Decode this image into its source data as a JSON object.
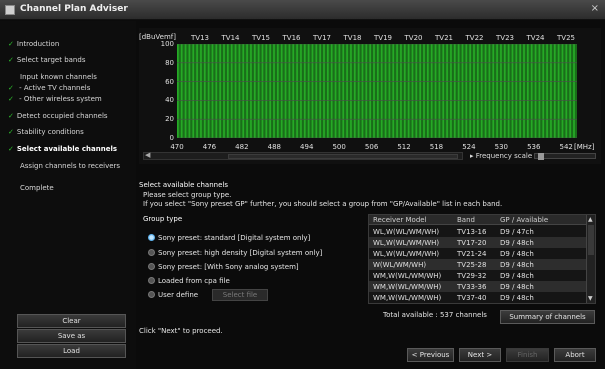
{
  "window": {
    "title": "Channel Plan Adviser",
    "close_glyph": "×"
  },
  "sidebar": {
    "steps": [
      {
        "label": "Introduction",
        "checked": true
      },
      {
        "label": "Select target bands",
        "checked": true
      },
      {
        "label": "Input known channels",
        "checked": false
      },
      {
        "label": " - Active TV channels",
        "checked": true
      },
      {
        "label": " - Other wireless system",
        "checked": true
      },
      {
        "label": "Detect occupied channels",
        "checked": true
      },
      {
        "label": "Stability conditions",
        "checked": true
      },
      {
        "label": "Select available channels",
        "checked": true,
        "active": true
      },
      {
        "label": "Assign channels to receivers",
        "checked": false
      },
      {
        "label": "Complete",
        "checked": false
      }
    ],
    "check_glyph": "✓",
    "buttons": {
      "clear": "Clear",
      "save_as": "Save as",
      "load": "Load"
    }
  },
  "chart_data": {
    "type": "bar",
    "y_unit": "[dBuVemf]",
    "x_unit": "[MHz]",
    "ylim": [
      0,
      100
    ],
    "yticks": [
      "100",
      "80",
      "60",
      "40",
      "20",
      "0"
    ],
    "xticks": [
      "470",
      "476",
      "482",
      "488",
      "494",
      "500",
      "506",
      "512",
      "518",
      "524",
      "530",
      "536",
      "542"
    ],
    "xlim": [
      470,
      544
    ],
    "tv_channels": [
      "TV13",
      "TV14",
      "TV15",
      "TV16",
      "TV17",
      "TV18",
      "TV19",
      "TV20",
      "TV21",
      "TV22",
      "TV23",
      "TV24",
      "TV25"
    ],
    "bar_step_mhz": 0.25,
    "bar_value": 100,
    "bar_color": "#2fd42f",
    "frequency_scale_label": "Frequency scale"
  },
  "main": {
    "section_title": "Select available channels",
    "desc_line1": "Please select group type.",
    "desc_line2": "If you select \"Sony preset GP\" further, you should select a group from \"GP/Available\" list in each band.",
    "group_type_label": "Group type",
    "options": [
      "Sony preset: standard [Digital system only]",
      "Sony preset: high density [Digital system only]",
      "Sony preset: [With Sony analog system]",
      "Loaded from cpa file",
      "User define"
    ],
    "selected_option": 0,
    "select_file_label": "Select file",
    "table": {
      "headers": [
        "Receiver Model",
        "Band",
        "GP / Available"
      ],
      "rows": [
        [
          "WL,W(WL/WM/WH)",
          "TV13-16",
          "D9 / 47ch"
        ],
        [
          "WL,W(WL/WM/WH)",
          "TV17-20",
          "D9 / 48ch"
        ],
        [
          "WL,W(WL/WM/WH)",
          "TV21-24",
          "D9 / 48ch"
        ],
        [
          "W(WL/WM/WH)",
          "TV25-28",
          "D9 / 48ch"
        ],
        [
          "WM,W(WL/WM/WH)",
          "TV29-32",
          "D9 / 48ch"
        ],
        [
          "WM,W(WL/WM/WH)",
          "TV33-36",
          "D9 / 48ch"
        ],
        [
          "WM,W(WL/WM/WH)",
          "TV37-40",
          "D9 / 48ch"
        ]
      ]
    },
    "total_label": "Total available : 537 channels",
    "summary_button": "Summary of channels",
    "proceed_text": "Click \"Next\" to proceed.",
    "nav": {
      "previous": "< Previous",
      "next": "Next >",
      "finish": "Finish",
      "abort": "Abort"
    }
  }
}
